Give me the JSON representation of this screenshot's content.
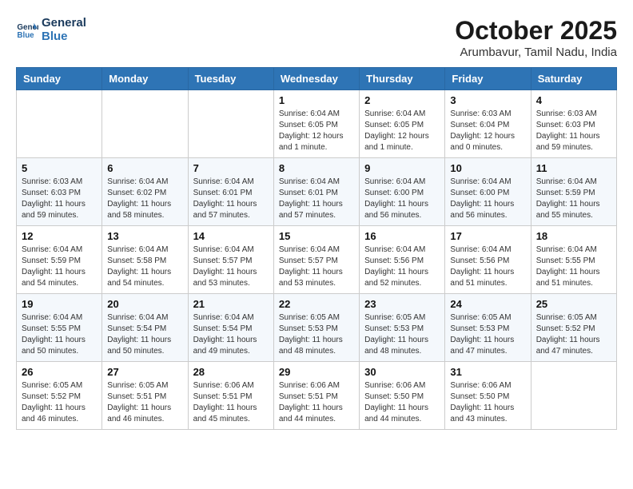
{
  "header": {
    "logo_line1": "General",
    "logo_line2": "Blue",
    "month_title": "October 2025",
    "location": "Arumbavur, Tamil Nadu, India"
  },
  "days_of_week": [
    "Sunday",
    "Monday",
    "Tuesday",
    "Wednesday",
    "Thursday",
    "Friday",
    "Saturday"
  ],
  "weeks": [
    [
      {
        "day": "",
        "info": ""
      },
      {
        "day": "",
        "info": ""
      },
      {
        "day": "",
        "info": ""
      },
      {
        "day": "1",
        "info": "Sunrise: 6:04 AM\nSunset: 6:05 PM\nDaylight: 12 hours\nand 1 minute."
      },
      {
        "day": "2",
        "info": "Sunrise: 6:04 AM\nSunset: 6:05 PM\nDaylight: 12 hours\nand 1 minute."
      },
      {
        "day": "3",
        "info": "Sunrise: 6:03 AM\nSunset: 6:04 PM\nDaylight: 12 hours\nand 0 minutes."
      },
      {
        "day": "4",
        "info": "Sunrise: 6:03 AM\nSunset: 6:03 PM\nDaylight: 11 hours\nand 59 minutes."
      }
    ],
    [
      {
        "day": "5",
        "info": "Sunrise: 6:03 AM\nSunset: 6:03 PM\nDaylight: 11 hours\nand 59 minutes."
      },
      {
        "day": "6",
        "info": "Sunrise: 6:04 AM\nSunset: 6:02 PM\nDaylight: 11 hours\nand 58 minutes."
      },
      {
        "day": "7",
        "info": "Sunrise: 6:04 AM\nSunset: 6:01 PM\nDaylight: 11 hours\nand 57 minutes."
      },
      {
        "day": "8",
        "info": "Sunrise: 6:04 AM\nSunset: 6:01 PM\nDaylight: 11 hours\nand 57 minutes."
      },
      {
        "day": "9",
        "info": "Sunrise: 6:04 AM\nSunset: 6:00 PM\nDaylight: 11 hours\nand 56 minutes."
      },
      {
        "day": "10",
        "info": "Sunrise: 6:04 AM\nSunset: 6:00 PM\nDaylight: 11 hours\nand 56 minutes."
      },
      {
        "day": "11",
        "info": "Sunrise: 6:04 AM\nSunset: 5:59 PM\nDaylight: 11 hours\nand 55 minutes."
      }
    ],
    [
      {
        "day": "12",
        "info": "Sunrise: 6:04 AM\nSunset: 5:59 PM\nDaylight: 11 hours\nand 54 minutes."
      },
      {
        "day": "13",
        "info": "Sunrise: 6:04 AM\nSunset: 5:58 PM\nDaylight: 11 hours\nand 54 minutes."
      },
      {
        "day": "14",
        "info": "Sunrise: 6:04 AM\nSunset: 5:57 PM\nDaylight: 11 hours\nand 53 minutes."
      },
      {
        "day": "15",
        "info": "Sunrise: 6:04 AM\nSunset: 5:57 PM\nDaylight: 11 hours\nand 53 minutes."
      },
      {
        "day": "16",
        "info": "Sunrise: 6:04 AM\nSunset: 5:56 PM\nDaylight: 11 hours\nand 52 minutes."
      },
      {
        "day": "17",
        "info": "Sunrise: 6:04 AM\nSunset: 5:56 PM\nDaylight: 11 hours\nand 51 minutes."
      },
      {
        "day": "18",
        "info": "Sunrise: 6:04 AM\nSunset: 5:55 PM\nDaylight: 11 hours\nand 51 minutes."
      }
    ],
    [
      {
        "day": "19",
        "info": "Sunrise: 6:04 AM\nSunset: 5:55 PM\nDaylight: 11 hours\nand 50 minutes."
      },
      {
        "day": "20",
        "info": "Sunrise: 6:04 AM\nSunset: 5:54 PM\nDaylight: 11 hours\nand 50 minutes."
      },
      {
        "day": "21",
        "info": "Sunrise: 6:04 AM\nSunset: 5:54 PM\nDaylight: 11 hours\nand 49 minutes."
      },
      {
        "day": "22",
        "info": "Sunrise: 6:05 AM\nSunset: 5:53 PM\nDaylight: 11 hours\nand 48 minutes."
      },
      {
        "day": "23",
        "info": "Sunrise: 6:05 AM\nSunset: 5:53 PM\nDaylight: 11 hours\nand 48 minutes."
      },
      {
        "day": "24",
        "info": "Sunrise: 6:05 AM\nSunset: 5:53 PM\nDaylight: 11 hours\nand 47 minutes."
      },
      {
        "day": "25",
        "info": "Sunrise: 6:05 AM\nSunset: 5:52 PM\nDaylight: 11 hours\nand 47 minutes."
      }
    ],
    [
      {
        "day": "26",
        "info": "Sunrise: 6:05 AM\nSunset: 5:52 PM\nDaylight: 11 hours\nand 46 minutes."
      },
      {
        "day": "27",
        "info": "Sunrise: 6:05 AM\nSunset: 5:51 PM\nDaylight: 11 hours\nand 46 minutes."
      },
      {
        "day": "28",
        "info": "Sunrise: 6:06 AM\nSunset: 5:51 PM\nDaylight: 11 hours\nand 45 minutes."
      },
      {
        "day": "29",
        "info": "Sunrise: 6:06 AM\nSunset: 5:51 PM\nDaylight: 11 hours\nand 44 minutes."
      },
      {
        "day": "30",
        "info": "Sunrise: 6:06 AM\nSunset: 5:50 PM\nDaylight: 11 hours\nand 44 minutes."
      },
      {
        "day": "31",
        "info": "Sunrise: 6:06 AM\nSunset: 5:50 PM\nDaylight: 11 hours\nand 43 minutes."
      },
      {
        "day": "",
        "info": ""
      }
    ]
  ]
}
